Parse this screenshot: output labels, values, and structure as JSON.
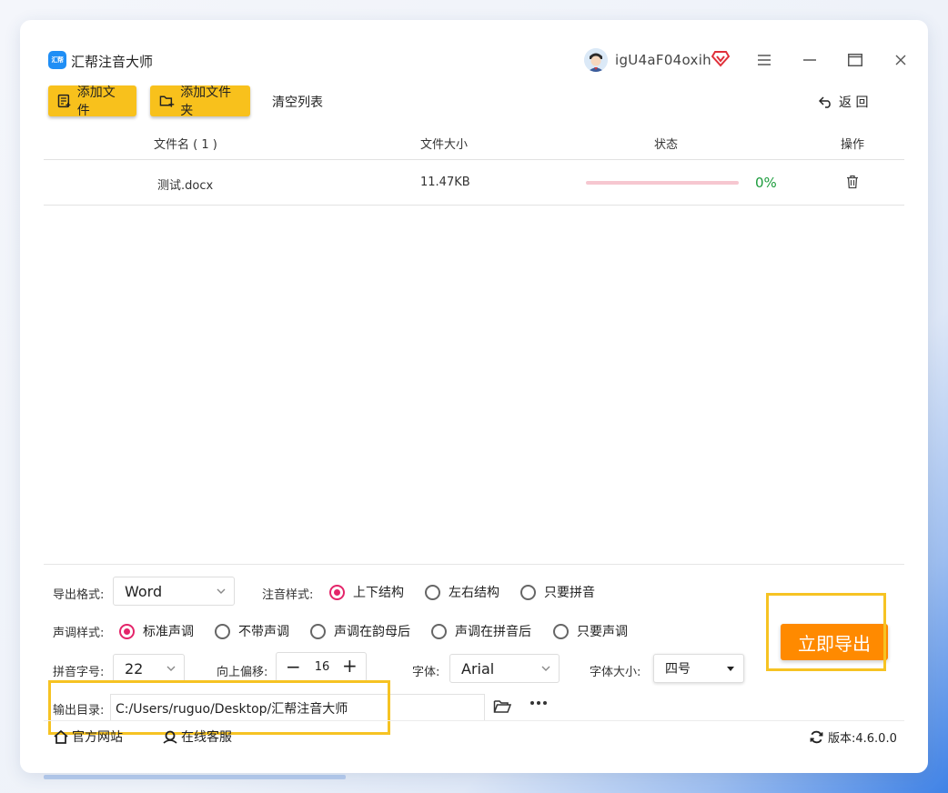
{
  "app": {
    "title": "汇帮注音大师",
    "logo_text": "汇帮",
    "username": "igU4aF04oxih"
  },
  "toolbar": {
    "add_file": "添加文件",
    "add_folder": "添加文件夹",
    "clear_list": "清空列表",
    "back": "返 回"
  },
  "table": {
    "columns": [
      "文件名 ( 1 )",
      "文件大小",
      "状态",
      "操作"
    ],
    "rows": [
      {
        "name": "测试.docx",
        "size": "11.47KB",
        "progress_percent": 0,
        "progress_label": "0%"
      }
    ]
  },
  "settings": {
    "export_format_label": "导出格式:",
    "export_format_value": "Word",
    "annotation_style_label": "注音样式:",
    "annotation_options": [
      "上下结构",
      "左右结构",
      "只要拼音"
    ],
    "annotation_selected": 0,
    "tone_style_label": "声调样式:",
    "tone_options": [
      "标准声调",
      "不带声调",
      "声调在韵母后",
      "声调在拼音后",
      "只要声调"
    ],
    "tone_selected": 0,
    "pinyin_size_label": "拼音字号:",
    "pinyin_size_value": "22",
    "offset_label": "向上偏移:",
    "offset_value": "16",
    "font_label": "字体:",
    "font_value": "Arial",
    "font_size_label": "字体大小:",
    "font_size_value": "四号",
    "output_dir_label": "输出目录:",
    "output_dir_value": "C:/Users/ruguo/Desktop/汇帮注音大师",
    "export_button": "立即导出"
  },
  "footer": {
    "website": "官方网站",
    "support": "在线客服",
    "version": "版本:4.6.0.0"
  },
  "colors": {
    "accent_yellow": "#f8c11c",
    "export_orange": "#ff8a00",
    "radio_active": "#e4256a",
    "highlight": "#f6c323"
  }
}
